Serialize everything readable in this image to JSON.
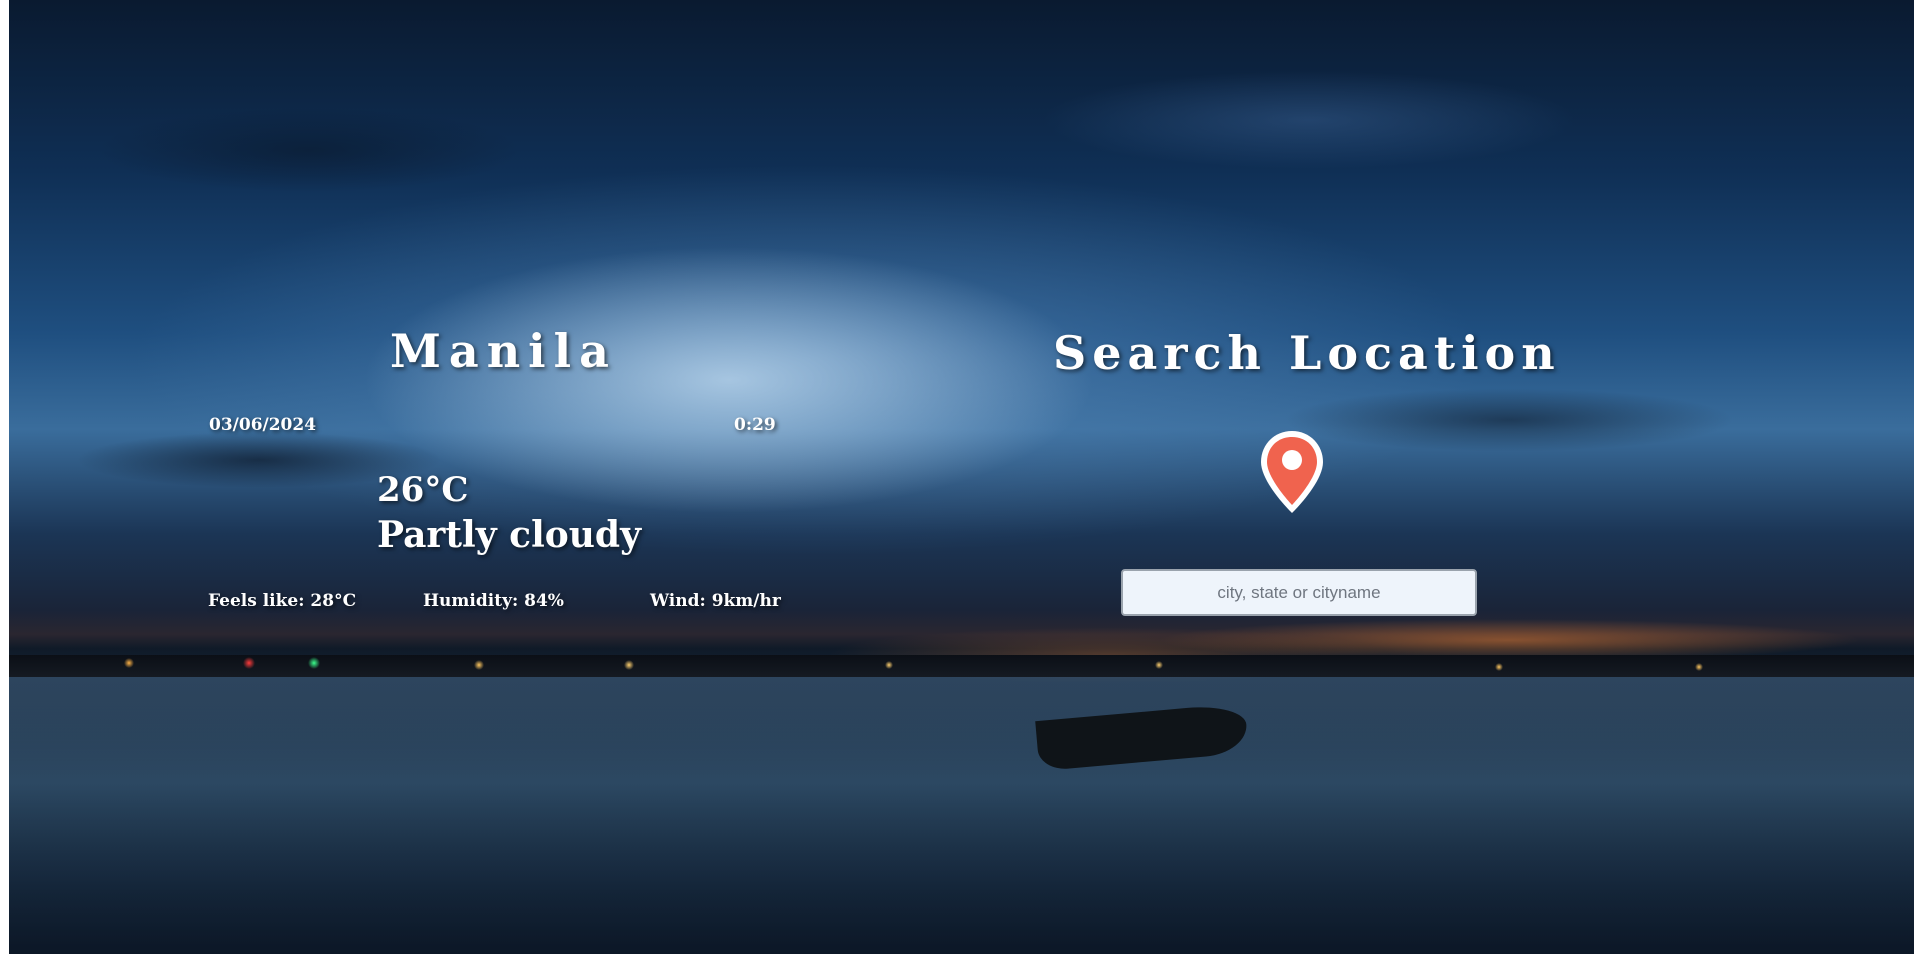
{
  "weather": {
    "city": "Manila",
    "date": "03/06/2024",
    "time": "0:29",
    "temperature": "26°C",
    "condition": "Partly cloudy",
    "feels_like": "Feels like: 28°C",
    "humidity": "Humidity: 84%",
    "wind": "Wind: 9km/hr"
  },
  "search": {
    "title": "Search Location",
    "placeholder": "city, state or cityname",
    "icon": "map-pin-icon",
    "icon_color": "#f0634e"
  }
}
